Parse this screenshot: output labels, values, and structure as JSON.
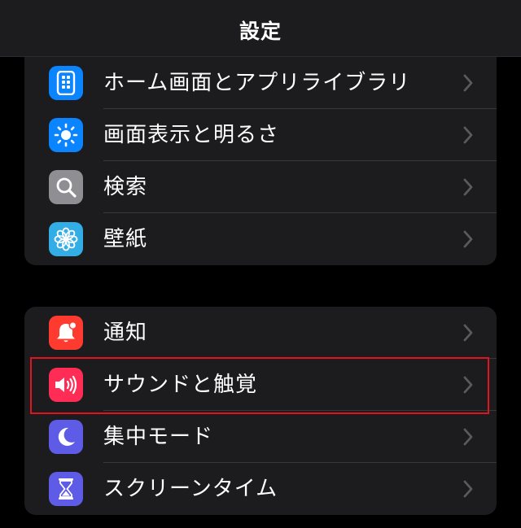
{
  "navbar": {
    "title": "設定"
  },
  "group1": {
    "items": [
      {
        "label": "ホーム画面とアプリライブラリ",
        "icon": "home-screen-icon",
        "color": "#0a84ff"
      },
      {
        "label": "画面表示と明るさ",
        "icon": "sun-icon",
        "color": "#0a84ff"
      },
      {
        "label": "検索",
        "icon": "search-icon",
        "color": "#8e8e93"
      },
      {
        "label": "壁紙",
        "icon": "flower-icon",
        "color": "#32ade6"
      }
    ]
  },
  "group2": {
    "items": [
      {
        "label": "通知",
        "icon": "bell-icon",
        "color": "#ff3b30"
      },
      {
        "label": "サウンドと触覚",
        "icon": "speaker-icon",
        "color": "#ff2d55"
      },
      {
        "label": "集中モード",
        "icon": "moon-icon",
        "color": "#5e5ce6"
      },
      {
        "label": "スクリーンタイム",
        "icon": "hourglass-icon",
        "color": "#5e5ce6"
      }
    ]
  },
  "highlight": {
    "color": "#e0141e"
  }
}
